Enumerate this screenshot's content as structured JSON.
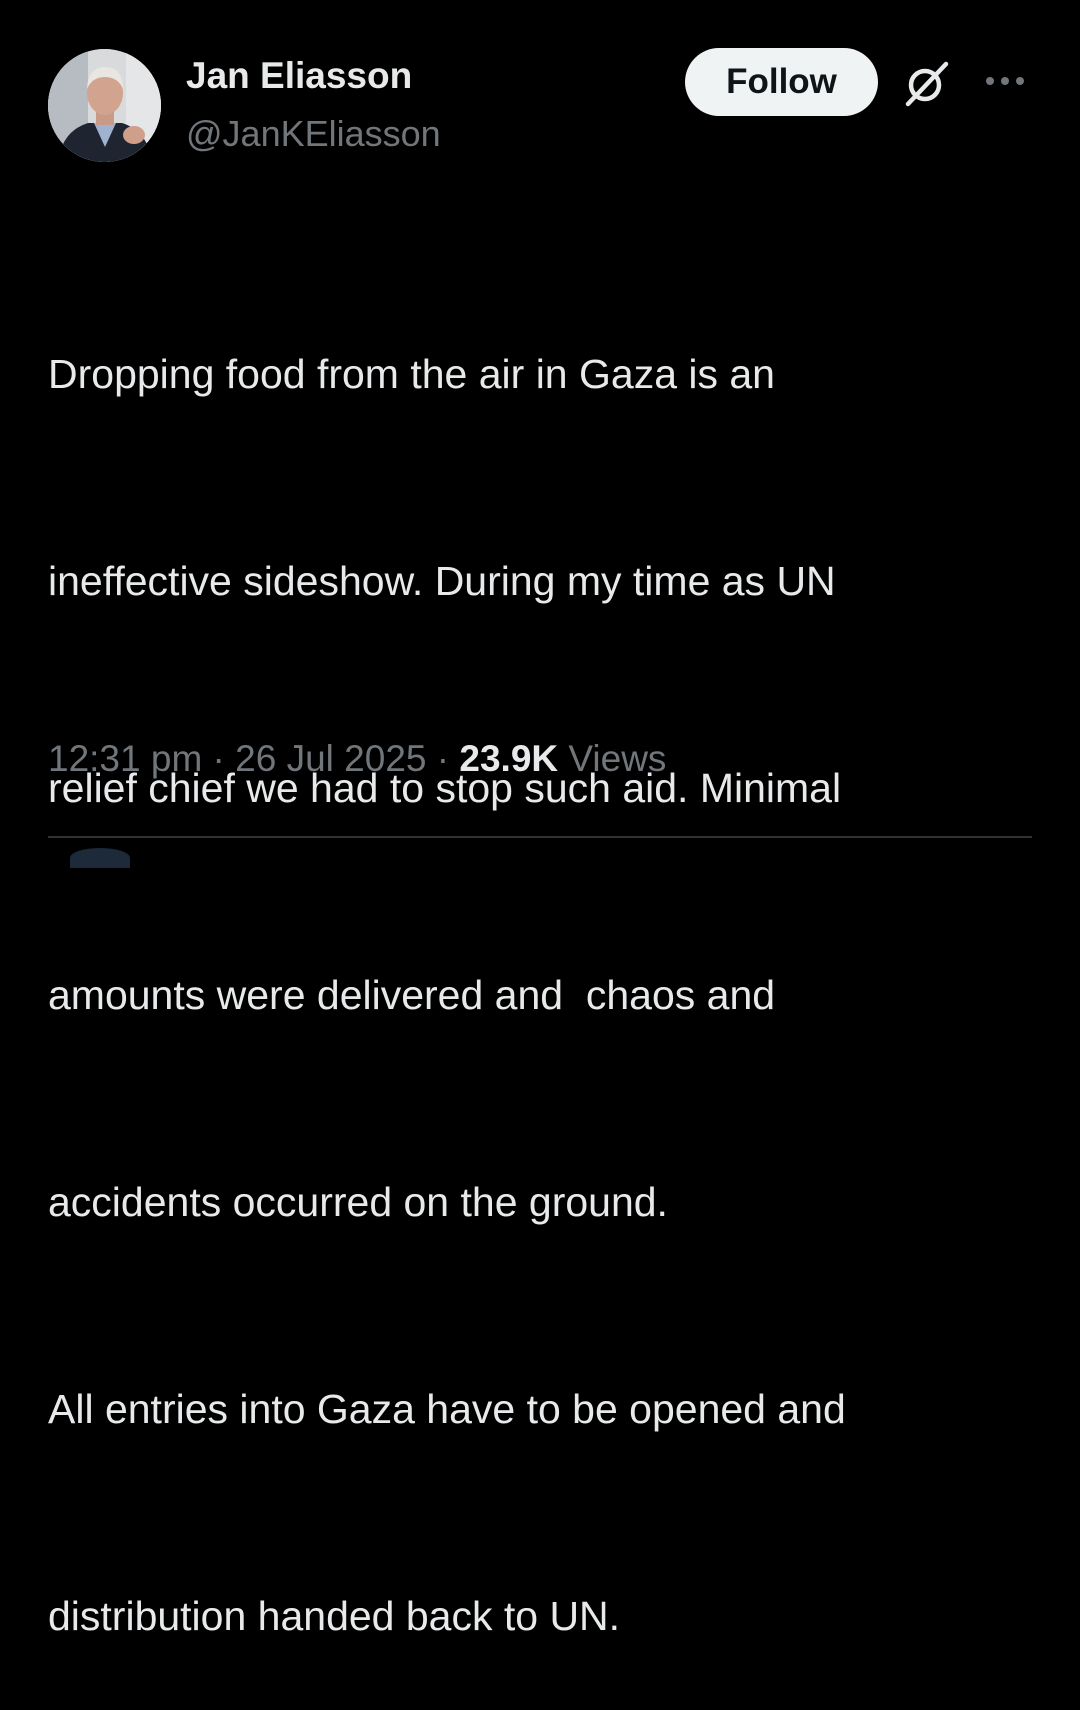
{
  "author": {
    "display_name": "Jan Eliasson",
    "handle": "@JanKEliasson"
  },
  "actions": {
    "follow_label": "Follow",
    "grok_icon": "grok-slash-icon",
    "more_icon": "more-dots-icon"
  },
  "tweet": {
    "lines": [
      "Dropping food from the air in Gaza is an",
      "ineffective sideshow. During my time as UN",
      "relief chief we had to stop such aid. Minimal",
      "amounts were delivered and  chaos and",
      "accidents occurred on the ground.",
      "All entries into Gaza have to be opened and",
      "distribution handed back to UN."
    ]
  },
  "meta": {
    "time": "12:31 pm",
    "separator": " · ",
    "date": "26 Jul 2025",
    "views_count": "23.9K",
    "views_label": " Views"
  },
  "colors": {
    "background": "#000000",
    "primary_text": "#e7e9ea",
    "secondary_text": "#71767b",
    "follow_button_bg": "#eff3f4",
    "divider": "#2f3336"
  }
}
